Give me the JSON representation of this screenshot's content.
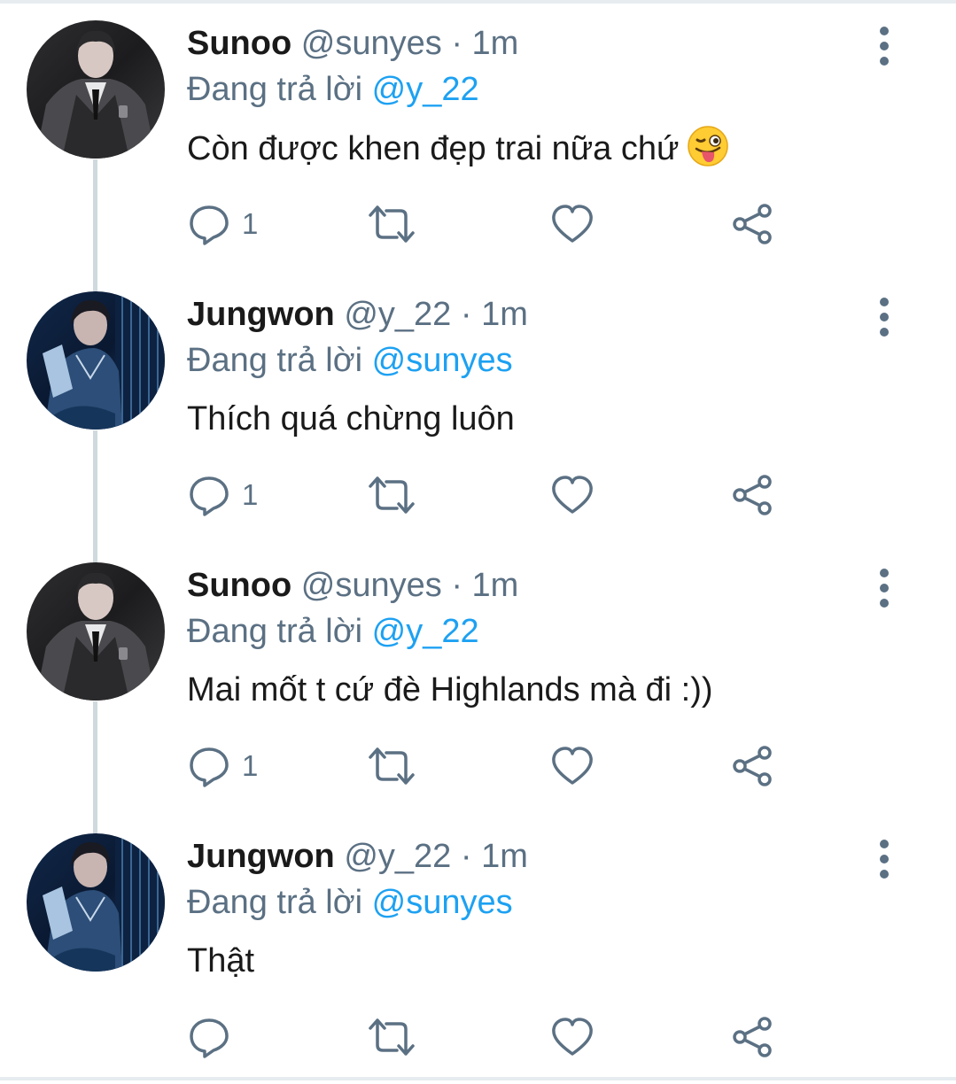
{
  "tweets": [
    {
      "name": "Sunoo",
      "handle": "@sunyes",
      "separator": "·",
      "time": "1m",
      "reply_prefix": "Đang trả lời",
      "reply_to": "@y_22",
      "text": "Còn được khen đẹp trai nữa chứ",
      "emoji": "winking-face-with-tongue",
      "reply_count": "1",
      "avatar": "sunoo-avatar"
    },
    {
      "name": "Jungwon",
      "handle": "@y_22",
      "separator": "·",
      "time": "1m",
      "reply_prefix": "Đang trả lời",
      "reply_to": "@sunyes",
      "text": "Thích quá chừng luôn",
      "reply_count": "1",
      "avatar": "jungwon-avatar"
    },
    {
      "name": "Sunoo",
      "handle": "@sunyes",
      "separator": "·",
      "time": "1m",
      "reply_prefix": "Đang trả lời",
      "reply_to": "@y_22",
      "text": "Mai mốt t cứ đè Highlands mà đi :))",
      "reply_count": "1",
      "avatar": "sunoo-avatar"
    },
    {
      "name": "Jungwon",
      "handle": "@y_22",
      "separator": "·",
      "time": "1m",
      "reply_prefix": "Đang trả lời",
      "reply_to": "@sunyes",
      "text": "Thật",
      "reply_count": "",
      "avatar": "jungwon-avatar"
    }
  ],
  "colors": {
    "link": "#1da1f2",
    "muted": "#5b7083",
    "thread_line": "#cfd9de",
    "text": "#1a1a1a"
  }
}
